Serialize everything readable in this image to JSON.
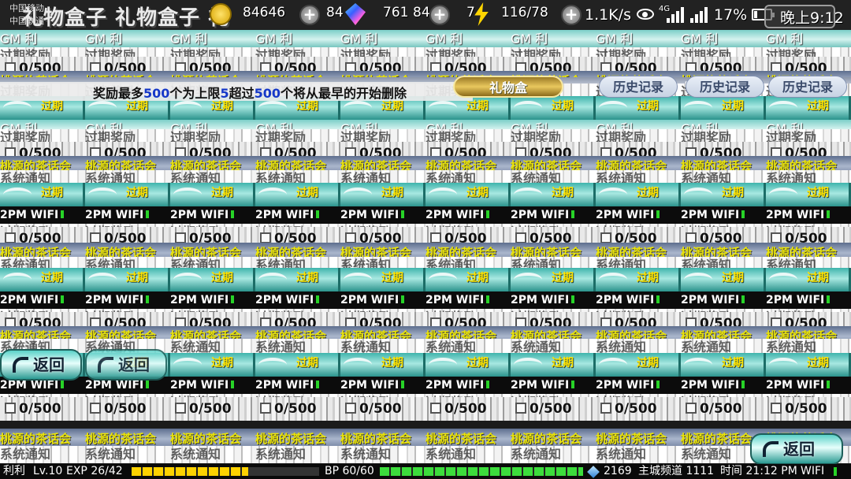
{
  "top": {
    "title": "礼物盒子 礼物盒子 礼",
    "sub_line_1": "中国移动",
    "sub_line_2": "中国联通",
    "coins": "84646",
    "gems": "84",
    "gem_count": "761",
    "gem_count_2": "84",
    "stamina_prefix": "7",
    "stamina": "116/78",
    "net_speed": "1.1K/s",
    "net_4g": "4G",
    "battery": "17%",
    "clock": "晚上9:12"
  },
  "tiles": {
    "gift_count": "0/500",
    "yellow_text": "桃源的茶话会",
    "yellow_text_2": "系统通知",
    "teal_text": "过期",
    "gm_text": "GM 利",
    "wifi_text": "2PM WIFI",
    "white_text": "过期奖励",
    "label_text": "历史记录"
  },
  "notice": {
    "prefix": "奖励最多",
    "max": "500",
    "middle": "个为上限",
    "limit_small": "5",
    "exceed": "超过",
    "exceed_num": "500",
    "suffix": "个将从最早的开始删除"
  },
  "tabs": {
    "active": "礼物盒",
    "history": "历史记录"
  },
  "back_button": {
    "label": "返回"
  },
  "bottom": {
    "player": "利利",
    "level": "Lv.10",
    "exp": "EXP 26/42",
    "exp_fraction": 0.62,
    "bp": "BP 60/60",
    "bp_fraction": 1.0,
    "gold": "2169",
    "channel": "主城频道 1111",
    "time": "时间 21:12 PM",
    "wifi": "WIFI"
  }
}
